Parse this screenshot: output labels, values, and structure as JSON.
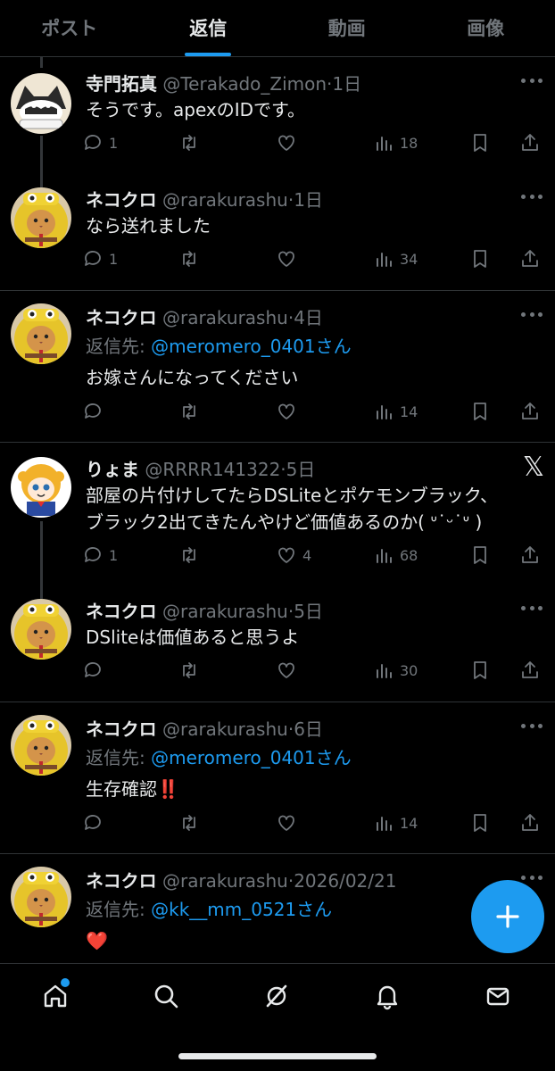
{
  "tabs": [
    "ポスト",
    "返信",
    "動画",
    "画像"
  ],
  "active_tab": "返信",
  "reply_prefix": "返信先: ",
  "reply_suffix": "さん",
  "tweets": [
    {
      "name": "寺門拓真",
      "handle": "@Terakado_Zimon",
      "time": "1日",
      "text": [
        "そうです。apexのIDです。"
      ],
      "replies": "1",
      "retweets": "",
      "likes": "",
      "views": "18"
    },
    {
      "name": "ネコクロ",
      "handle": "@rarakurashu",
      "time": "1日",
      "text": [
        "なら送れました"
      ],
      "replies": "1",
      "retweets": "",
      "likes": "",
      "views": "34"
    },
    {
      "name": "ネコクロ",
      "handle": "@rarakurashu",
      "time": "4日",
      "reply_to": "@meromero_0401",
      "text": [
        "お嫁さんになってください"
      ],
      "replies": "",
      "retweets": "",
      "likes": "",
      "views": "14"
    },
    {
      "name": "りょま",
      "handle": "@RRRR141322",
      "time": "5日",
      "text": [
        "部屋の片付けしてたらDSLiteとポケモンブラック、",
        "ブラック2出てきたんやけど価値あるのか( ᐡ˙ᵕ˙ᐡ )"
      ],
      "replies": "1",
      "retweets": "",
      "likes": "4",
      "views": "68"
    },
    {
      "name": "ネコクロ",
      "handle": "@rarakurashu",
      "time": "5日",
      "text": [
        "DSliteは価値あると思うよ"
      ],
      "replies": "",
      "retweets": "",
      "likes": "",
      "views": "30"
    },
    {
      "name": "ネコクロ",
      "handle": "@rarakurashu",
      "time": "6日",
      "reply_to": "@meromero_0401",
      "text": [
        "生存確認‼️"
      ],
      "replies": "",
      "retweets": "",
      "likes": "",
      "views": "14"
    },
    {
      "name": "ネコクロ",
      "handle": "@rarakurashu",
      "time": "2026/02/21",
      "reply_to": "@kk__mm_0521",
      "text": [
        "❤️"
      ]
    }
  ],
  "icons": {
    "nav": [
      "home-icon",
      "search-icon",
      "grok-icon",
      "notifications-icon",
      "messages-icon"
    ],
    "actions": [
      "reply-icon",
      "retweet-icon",
      "like-icon",
      "views-icon",
      "bookmark-icon",
      "share-icon"
    ],
    "fab": "compose-plus-icon"
  },
  "colors": {
    "accent": "#1d9bf0",
    "muted": "#71767b",
    "text": "#e7e9ea",
    "background": "#000000",
    "divider": "#2f3336"
  }
}
